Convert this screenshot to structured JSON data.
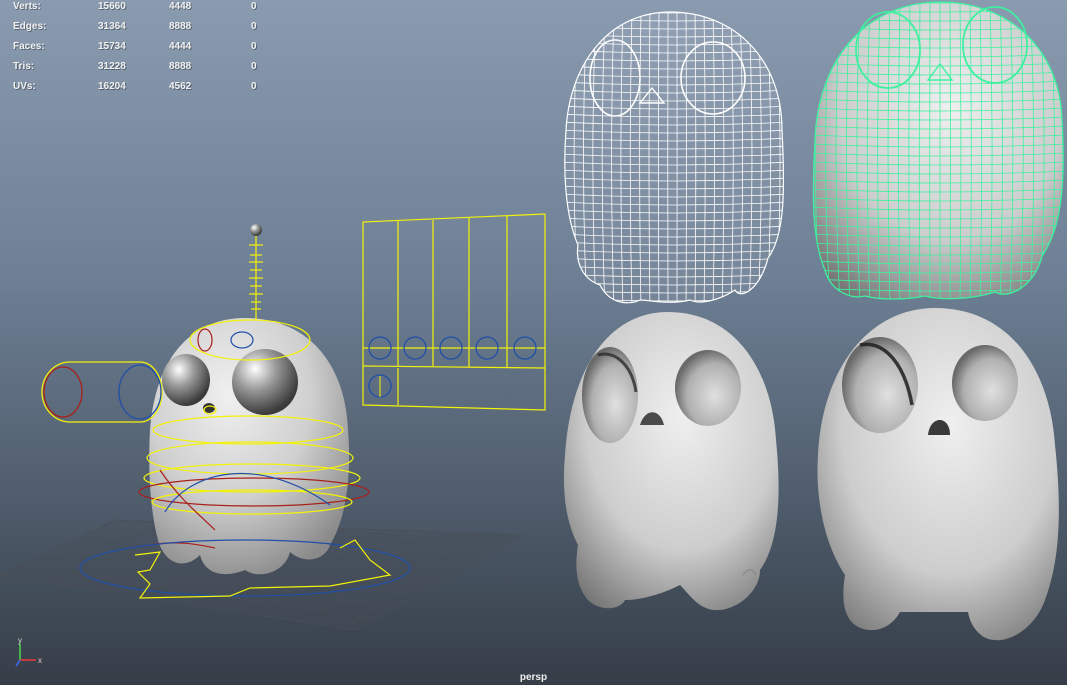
{
  "hud": {
    "rows": [
      {
        "label": "Verts:",
        "v1": "15660",
        "v2": "4448",
        "v3": "0"
      },
      {
        "label": "Edges:",
        "v1": "31364",
        "v2": "8888",
        "v3": "0"
      },
      {
        "label": "Faces:",
        "v1": "15734",
        "v2": "4444",
        "v3": "0"
      },
      {
        "label": "Tris:",
        "v1": "31228",
        "v2": "8888",
        "v3": "0"
      },
      {
        "label": "UVs:",
        "v1": "16204",
        "v2": "4562",
        "v3": "0"
      }
    ]
  },
  "viewport": {
    "camera": "persp",
    "axis_labels": {
      "y": "y",
      "x": "x"
    }
  },
  "colors": {
    "rig_control": "#f2f20a",
    "rig_blue": "#1f4fa8",
    "rig_red": "#a8201a",
    "selected_wire": "#3ef0a0",
    "wireframe": "#ffffff"
  },
  "icons": [
    "axis-gizmo-icon"
  ]
}
